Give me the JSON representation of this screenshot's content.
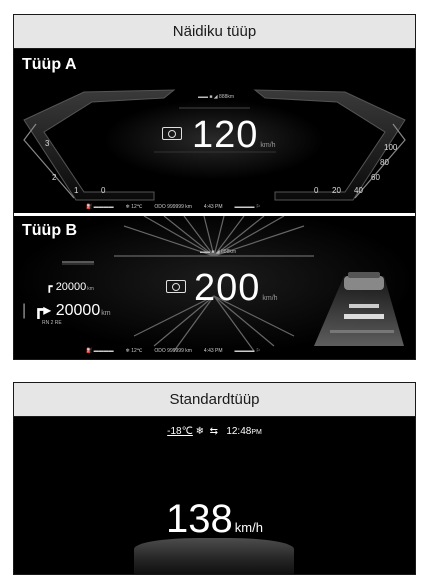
{
  "top_panel": {
    "header": "Näidiku tüüp",
    "type_a": {
      "label": "Tüüp A",
      "speed": "120",
      "speed_unit": "km/h",
      "top_indicator": "▬▬ ■ ◢ 888km",
      "left_ticks": [
        "1",
        "2",
        "3"
      ],
      "right_ticks": [
        "20",
        "40",
        "60",
        "80",
        "100"
      ],
      "left_gear": "0",
      "right_zero": "0",
      "status": [
        "⛽ ▬▬▬▬",
        "❄ 12℃",
        "ODO 999999 km",
        "4:43 PM",
        "▬▬▬▬ ⚐"
      ]
    },
    "type_b": {
      "label": "Tüüp B",
      "speed": "200",
      "speed_unit": "km/h",
      "top_indicator": "▬▬ ■ ◢ 888km",
      "nav_small": "20000",
      "nav_small_unit": "km",
      "nav_large": "20000",
      "nav_large_unit": "km",
      "nav_road": "RN 2 RE",
      "status": [
        "⛽ ▬▬▬▬",
        "❄ 12℃",
        "ODO 999999 km",
        "4:43 PM",
        "▬▬▬▬ ⚐"
      ]
    }
  },
  "bottom_panel": {
    "header": "Standardtüüp",
    "temperature": "-18℃",
    "snow_icon": "❄",
    "car_icon": "⇆",
    "time": "12:48",
    "time_suffix": "PM",
    "speed": "138",
    "speed_unit": "km/h"
  }
}
